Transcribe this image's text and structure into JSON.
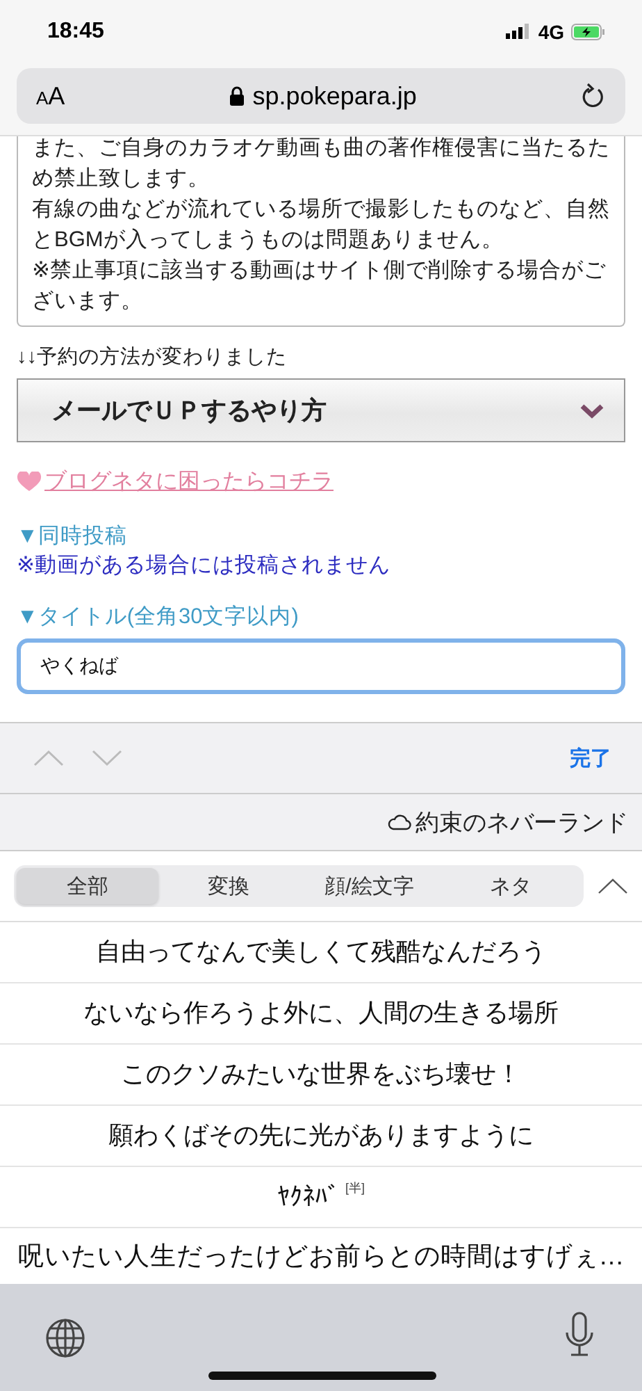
{
  "status_bar": {
    "time": "18:45",
    "network": "4G"
  },
  "browser": {
    "text_size": "AA",
    "url": "sp.pokepara.jp"
  },
  "notice": {
    "lines": [
      "また、ご自身のカラオケ動画も曲の著作権侵害に当たるため禁止致します。",
      "有線の曲などが流れている場所で撮影したものなど、自然とBGMが入ってしまうものは問題ありません。",
      "※禁止事項に該当する動画はサイト側で削除する場合がございます。"
    ]
  },
  "method_label": "↓↓予約の方法が変わりました",
  "method_select": {
    "value": "メールでＵＰするやり方"
  },
  "blog_link": "ブログネタに困ったらコチラ",
  "simultaneous": {
    "label": "▼同時投稿",
    "note": "※動画がある場合には投稿されません"
  },
  "title_field": {
    "label": "▼タイトル(全角30文字以内)",
    "value": "やくねば"
  },
  "accessory": {
    "done": "完了"
  },
  "prediction": "約束のネバーランド",
  "candidate_tabs": [
    {
      "label": "全部",
      "selected": true
    },
    {
      "label": "変換",
      "selected": false
    },
    {
      "label": "顔/絵文字",
      "selected": false
    },
    {
      "label": "ネタ",
      "selected": false
    }
  ],
  "candidates": [
    {
      "kind": "text",
      "text": "自由ってなんで美しくて残酷なんだろう"
    },
    {
      "kind": "text",
      "text": "ないなら作ろうよ外に、人間の生きる場所"
    },
    {
      "kind": "text",
      "text": "このクソみたいな世界をぶち壊せ！"
    },
    {
      "kind": "text",
      "text": "願わくばその先に光がありますように"
    },
    {
      "kind": "tagged",
      "text": "ﾔｸﾈﾊﾞ",
      "tag": "[半]"
    },
    {
      "kind": "text",
      "text": "呪いたい人生だったけどお前らとの時間はすげぇ…"
    }
  ]
}
